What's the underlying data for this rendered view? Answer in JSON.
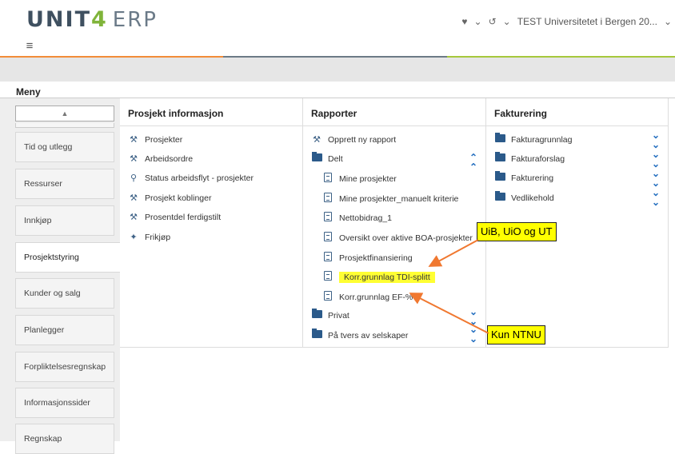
{
  "header": {
    "logo_prefix": "UNIT",
    "logo_four": "4",
    "logo_suffix": "ERP",
    "company": "TEST Universitetet i Bergen 20...",
    "icons": [
      "heart-icon",
      "chevron-down-icon",
      "history-icon",
      "chevron-down-icon",
      "chevron-down-icon"
    ]
  },
  "menu_label": "Meny",
  "sidebar": {
    "scroll_up": "▲",
    "items": [
      {
        "label": "Tid og utlegg"
      },
      {
        "label": "Ressurser"
      },
      {
        "label": "Innkjøp"
      },
      {
        "label": "Prosjektstyring"
      },
      {
        "label": "Kunder og salg"
      },
      {
        "label": "Planlegger"
      },
      {
        "label": "Forpliktelsesregnskap"
      },
      {
        "label": "Informasjonssider"
      },
      {
        "label": "Regnskap"
      }
    ]
  },
  "columns": [
    {
      "title": "Prosjekt informasjon",
      "items": [
        {
          "label": "Prosjekter",
          "icon": "wrench-icon"
        },
        {
          "label": "Arbeidsordre",
          "icon": "wrench-icon"
        },
        {
          "label": "Status arbeidsflyt - prosjekter",
          "icon": "search-icon"
        },
        {
          "label": "Prosjekt koblinger",
          "icon": "wrench-icon"
        },
        {
          "label": "Prosentdel ferdigstilt",
          "icon": "wrench-icon"
        },
        {
          "label": "Frikjøp",
          "icon": "tool-icon"
        }
      ]
    },
    {
      "title": "Rapporter",
      "items": [
        {
          "label": "Opprett ny rapport",
          "icon": "wrench-icon"
        },
        {
          "label": "Delt",
          "icon": "folder-open-icon"
        },
        {
          "label": "Mine prosjekter",
          "icon": "report-icon"
        },
        {
          "label": "Mine prosjekter_manuelt kriterie",
          "icon": "report-icon"
        },
        {
          "label": "Nettobidrag_1",
          "icon": "report-icon"
        },
        {
          "label": "Oversikt over aktive BOA-prosjekter",
          "icon": "report-icon"
        },
        {
          "label": "Prosjektfinansiering",
          "icon": "document-icon"
        },
        {
          "label": "Korr.grunnlag TDI-splitt",
          "icon": "document-icon"
        },
        {
          "label": "Korr.grunnlag EF-%",
          "icon": "document-icon"
        },
        {
          "label": "Privat",
          "icon": "folder-icon"
        },
        {
          "label": "På tvers av selskaper",
          "icon": "folder-icon"
        }
      ]
    },
    {
      "title": "Fakturering",
      "items": [
        {
          "label": "Fakturagrunnlag",
          "icon": "folder-icon"
        },
        {
          "label": "Fakturaforslag",
          "icon": "folder-icon"
        },
        {
          "label": "Fakturering",
          "icon": "folder-icon"
        },
        {
          "label": "Vedlikehold",
          "icon": "folder-icon"
        }
      ]
    }
  ],
  "callouts": {
    "uib": "UiB, UiO og UT",
    "ntnu": "Kun NTNU"
  },
  "colors": {
    "accent_orange": "#f28c38",
    "accent_grey": "#6c7a86",
    "accent_green": "#a6c83c",
    "highlight_yellow": "#ffff33",
    "arrow": "#f07830",
    "icon_blue": "#2b5a8a",
    "chevron_blue": "#2670c0"
  }
}
